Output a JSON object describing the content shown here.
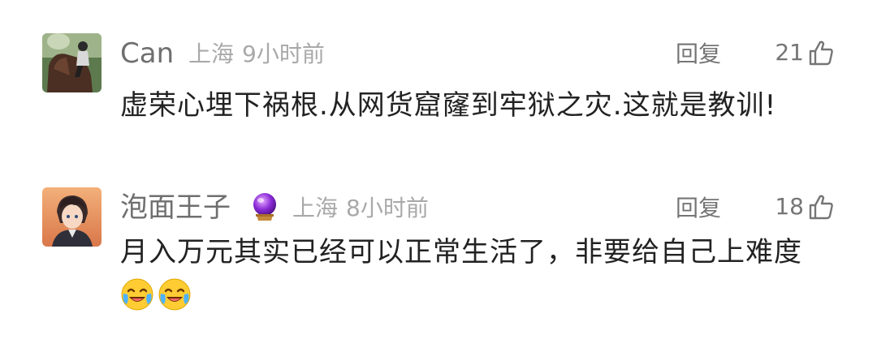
{
  "comments": [
    {
      "username": "Can",
      "location": "上海",
      "time": "9小时前",
      "reply_label": "回复",
      "likes": "21",
      "text": "虚荣心埋下祸根.从网货窟窿到牢狱之灾.这就是教训!",
      "avatar_icon": "horse-rider-avatar"
    },
    {
      "username": "泡面王子",
      "badge_icon": "crystal-ball-icon",
      "location": "上海",
      "time": "8小时前",
      "reply_label": "回复",
      "likes": "18",
      "text": "月入万元其实已经可以正常生活了，非要给自己上难度",
      "emojis": [
        "laughing-crying-emoji",
        "laughing-crying-emoji"
      ],
      "avatar_icon": "anime-character-avatar"
    }
  ],
  "colors": {
    "username": "#6f6f6f",
    "meta": "#a9a9a9",
    "body_text": "#222222",
    "action": "#757575"
  }
}
